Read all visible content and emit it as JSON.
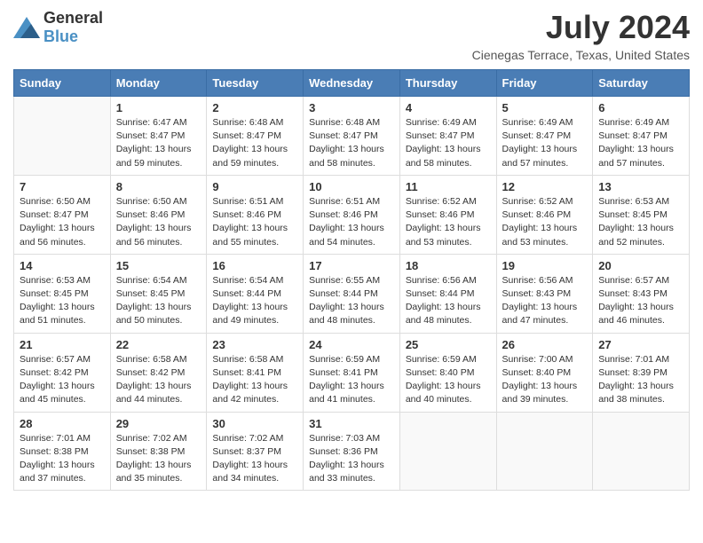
{
  "logo": {
    "text_general": "General",
    "text_blue": "Blue"
  },
  "title": "July 2024",
  "location": "Cienegas Terrace, Texas, United States",
  "days_header": [
    "Sunday",
    "Monday",
    "Tuesday",
    "Wednesday",
    "Thursday",
    "Friday",
    "Saturday"
  ],
  "weeks": [
    [
      {
        "day": "",
        "info": ""
      },
      {
        "day": "1",
        "info": "Sunrise: 6:47 AM\nSunset: 8:47 PM\nDaylight: 13 hours\nand 59 minutes."
      },
      {
        "day": "2",
        "info": "Sunrise: 6:48 AM\nSunset: 8:47 PM\nDaylight: 13 hours\nand 59 minutes."
      },
      {
        "day": "3",
        "info": "Sunrise: 6:48 AM\nSunset: 8:47 PM\nDaylight: 13 hours\nand 58 minutes."
      },
      {
        "day": "4",
        "info": "Sunrise: 6:49 AM\nSunset: 8:47 PM\nDaylight: 13 hours\nand 58 minutes."
      },
      {
        "day": "5",
        "info": "Sunrise: 6:49 AM\nSunset: 8:47 PM\nDaylight: 13 hours\nand 57 minutes."
      },
      {
        "day": "6",
        "info": "Sunrise: 6:49 AM\nSunset: 8:47 PM\nDaylight: 13 hours\nand 57 minutes."
      }
    ],
    [
      {
        "day": "7",
        "info": "Sunrise: 6:50 AM\nSunset: 8:47 PM\nDaylight: 13 hours\nand 56 minutes."
      },
      {
        "day": "8",
        "info": "Sunrise: 6:50 AM\nSunset: 8:46 PM\nDaylight: 13 hours\nand 56 minutes."
      },
      {
        "day": "9",
        "info": "Sunrise: 6:51 AM\nSunset: 8:46 PM\nDaylight: 13 hours\nand 55 minutes."
      },
      {
        "day": "10",
        "info": "Sunrise: 6:51 AM\nSunset: 8:46 PM\nDaylight: 13 hours\nand 54 minutes."
      },
      {
        "day": "11",
        "info": "Sunrise: 6:52 AM\nSunset: 8:46 PM\nDaylight: 13 hours\nand 53 minutes."
      },
      {
        "day": "12",
        "info": "Sunrise: 6:52 AM\nSunset: 8:46 PM\nDaylight: 13 hours\nand 53 minutes."
      },
      {
        "day": "13",
        "info": "Sunrise: 6:53 AM\nSunset: 8:45 PM\nDaylight: 13 hours\nand 52 minutes."
      }
    ],
    [
      {
        "day": "14",
        "info": "Sunrise: 6:53 AM\nSunset: 8:45 PM\nDaylight: 13 hours\nand 51 minutes."
      },
      {
        "day": "15",
        "info": "Sunrise: 6:54 AM\nSunset: 8:45 PM\nDaylight: 13 hours\nand 50 minutes."
      },
      {
        "day": "16",
        "info": "Sunrise: 6:54 AM\nSunset: 8:44 PM\nDaylight: 13 hours\nand 49 minutes."
      },
      {
        "day": "17",
        "info": "Sunrise: 6:55 AM\nSunset: 8:44 PM\nDaylight: 13 hours\nand 48 minutes."
      },
      {
        "day": "18",
        "info": "Sunrise: 6:56 AM\nSunset: 8:44 PM\nDaylight: 13 hours\nand 48 minutes."
      },
      {
        "day": "19",
        "info": "Sunrise: 6:56 AM\nSunset: 8:43 PM\nDaylight: 13 hours\nand 47 minutes."
      },
      {
        "day": "20",
        "info": "Sunrise: 6:57 AM\nSunset: 8:43 PM\nDaylight: 13 hours\nand 46 minutes."
      }
    ],
    [
      {
        "day": "21",
        "info": "Sunrise: 6:57 AM\nSunset: 8:42 PM\nDaylight: 13 hours\nand 45 minutes."
      },
      {
        "day": "22",
        "info": "Sunrise: 6:58 AM\nSunset: 8:42 PM\nDaylight: 13 hours\nand 44 minutes."
      },
      {
        "day": "23",
        "info": "Sunrise: 6:58 AM\nSunset: 8:41 PM\nDaylight: 13 hours\nand 42 minutes."
      },
      {
        "day": "24",
        "info": "Sunrise: 6:59 AM\nSunset: 8:41 PM\nDaylight: 13 hours\nand 41 minutes."
      },
      {
        "day": "25",
        "info": "Sunrise: 6:59 AM\nSunset: 8:40 PM\nDaylight: 13 hours\nand 40 minutes."
      },
      {
        "day": "26",
        "info": "Sunrise: 7:00 AM\nSunset: 8:40 PM\nDaylight: 13 hours\nand 39 minutes."
      },
      {
        "day": "27",
        "info": "Sunrise: 7:01 AM\nSunset: 8:39 PM\nDaylight: 13 hours\nand 38 minutes."
      }
    ],
    [
      {
        "day": "28",
        "info": "Sunrise: 7:01 AM\nSunset: 8:38 PM\nDaylight: 13 hours\nand 37 minutes."
      },
      {
        "day": "29",
        "info": "Sunrise: 7:02 AM\nSunset: 8:38 PM\nDaylight: 13 hours\nand 35 minutes."
      },
      {
        "day": "30",
        "info": "Sunrise: 7:02 AM\nSunset: 8:37 PM\nDaylight: 13 hours\nand 34 minutes."
      },
      {
        "day": "31",
        "info": "Sunrise: 7:03 AM\nSunset: 8:36 PM\nDaylight: 13 hours\nand 33 minutes."
      },
      {
        "day": "",
        "info": ""
      },
      {
        "day": "",
        "info": ""
      },
      {
        "day": "",
        "info": ""
      }
    ]
  ]
}
